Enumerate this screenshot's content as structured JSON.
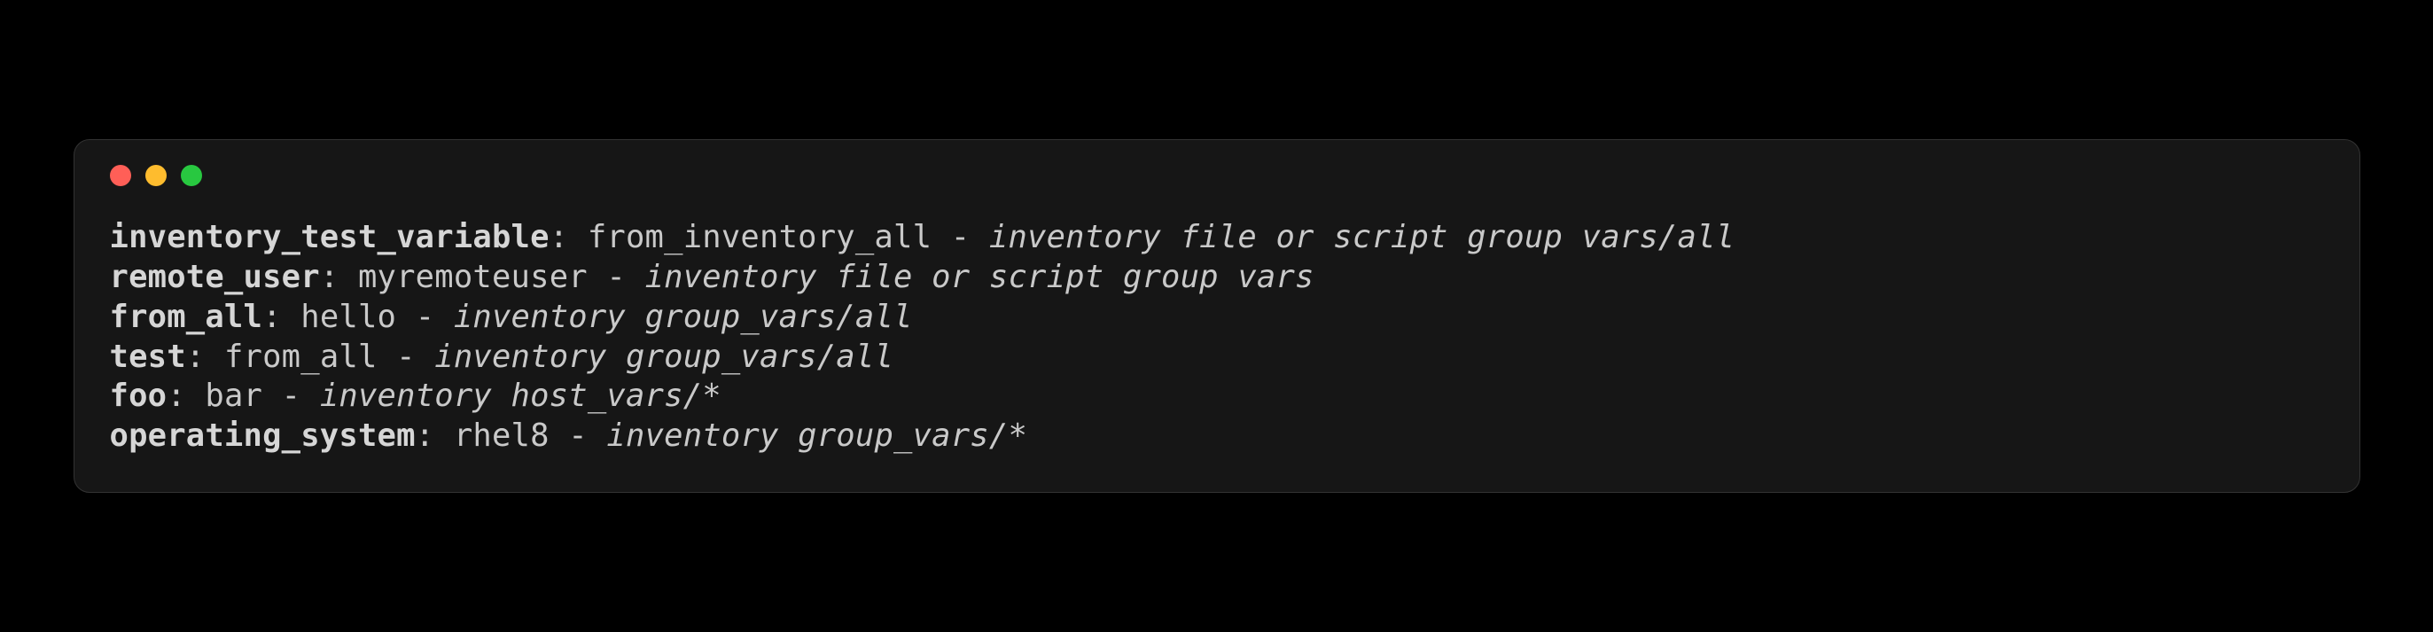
{
  "lines": [
    {
      "key": "inventory_test_variable",
      "value": "from_inventory_all",
      "comment": "inventory file or script group vars/all"
    },
    {
      "key": "remote_user",
      "value": "myremoteuser",
      "comment": "inventory file or script group vars"
    },
    {
      "key": "from_all",
      "value": "hello",
      "comment": "inventory group_vars/all"
    },
    {
      "key": "test",
      "value": "from_all",
      "comment": "inventory group_vars/all"
    },
    {
      "key": "foo",
      "value": "bar",
      "comment": "inventory host_vars/*"
    },
    {
      "key": "operating_system",
      "value": "rhel8",
      "comment": "inventory group_vars/*"
    }
  ],
  "separators": {
    "colon": ":",
    "dash": " - "
  }
}
